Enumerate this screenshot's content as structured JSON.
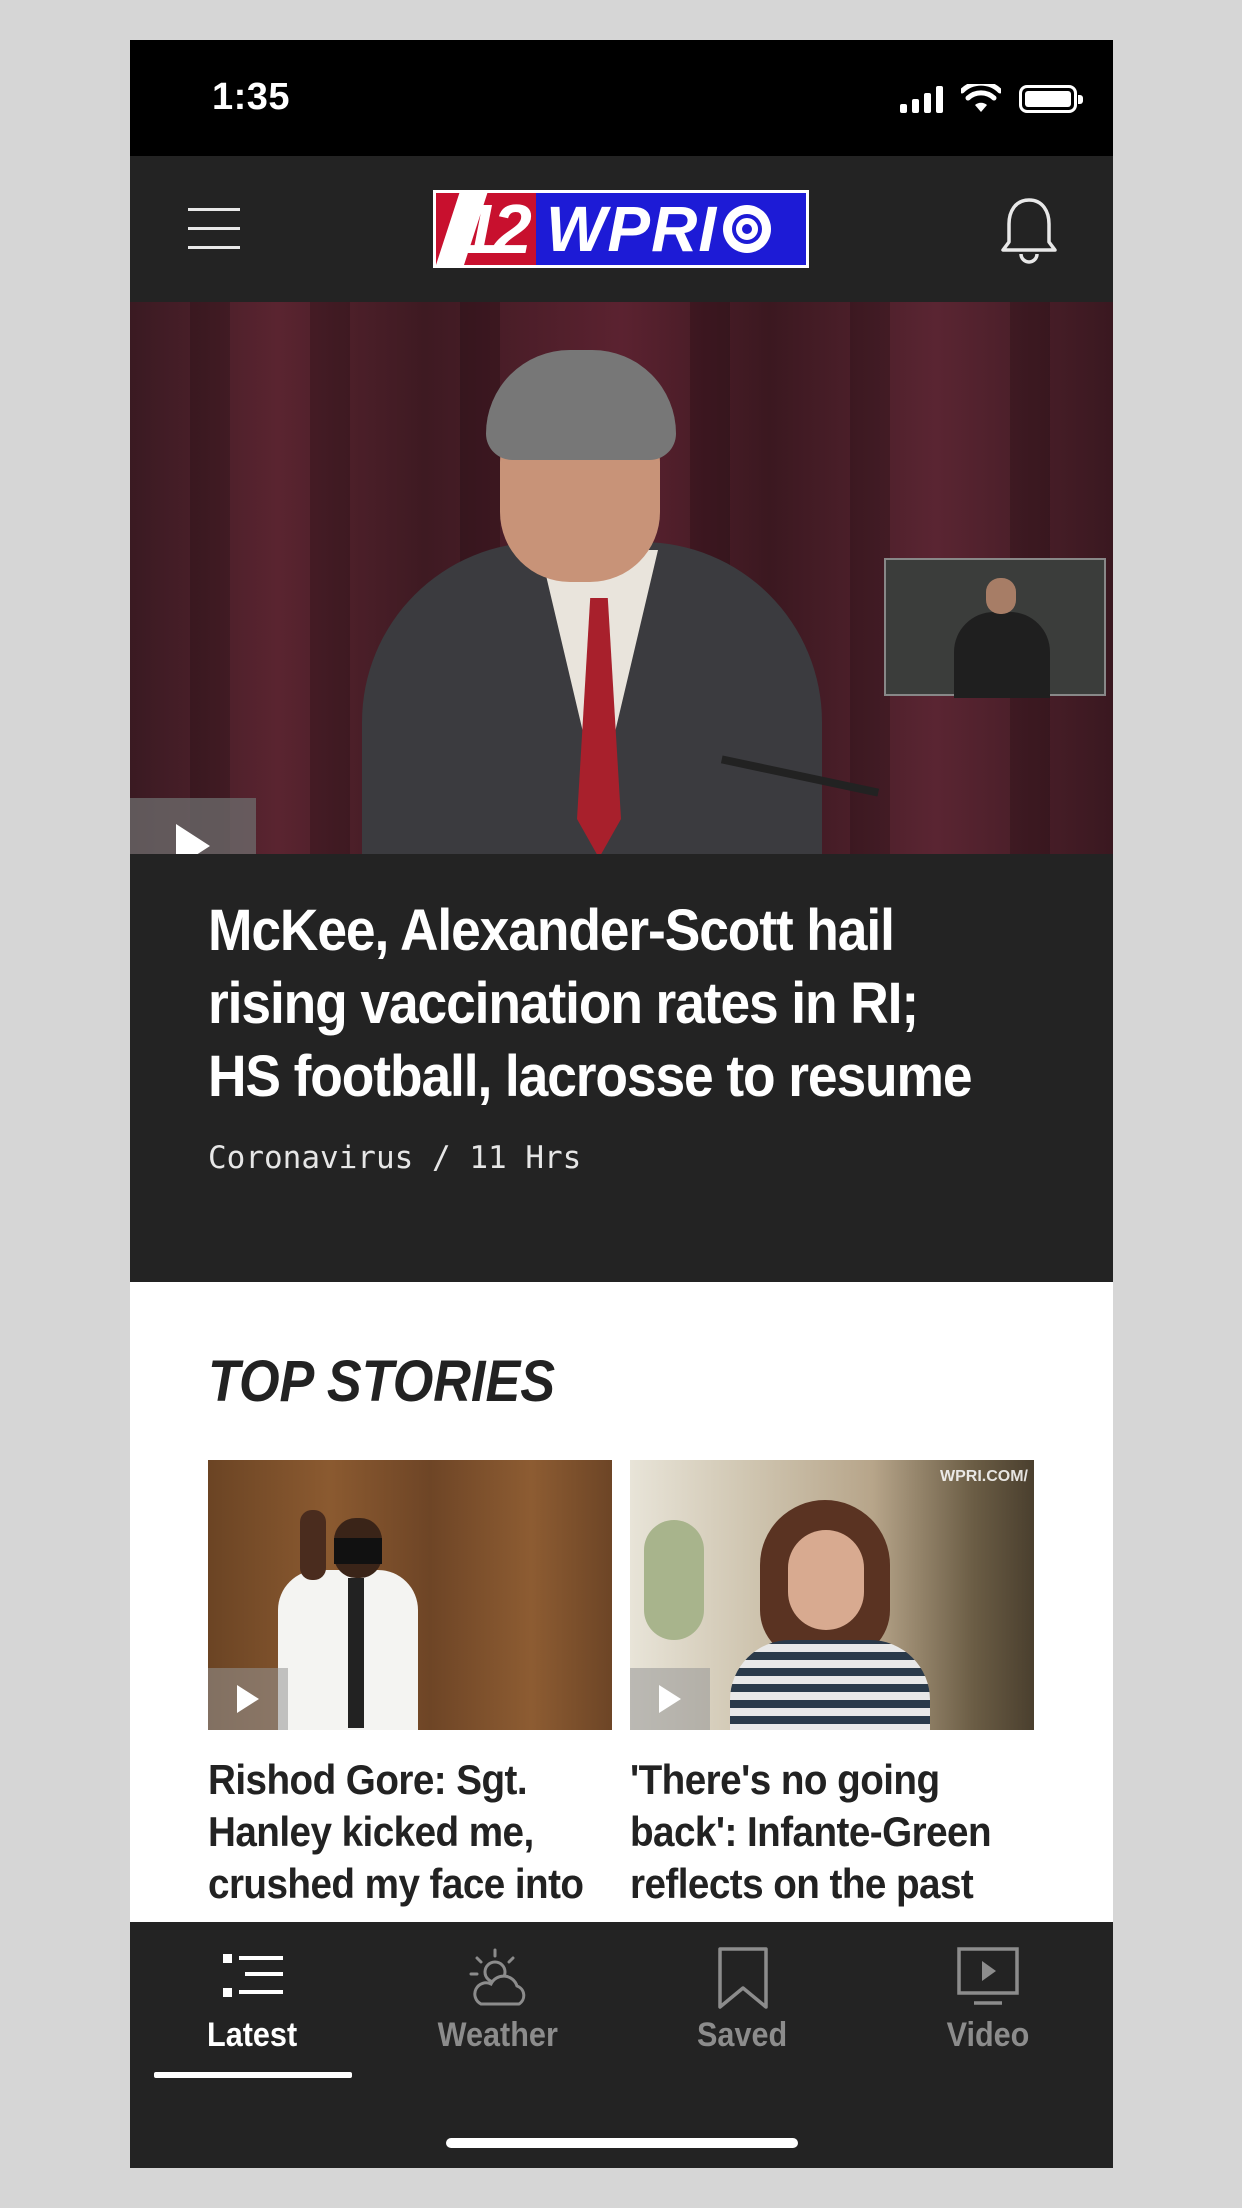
{
  "status_bar": {
    "time": "1:35"
  },
  "header": {
    "logo_number": "12",
    "logo_text": "WPRI"
  },
  "hero": {
    "title": "McKee, Alexander-Scott hail rising vaccination rates in RI; HS football, lacrosse to resume",
    "category": "Coronavirus",
    "separator": "/",
    "age": "11 Hrs"
  },
  "top_stories": {
    "heading": "TOP STORIES",
    "cards": [
      {
        "title": "Rishod Gore: Sgt. Hanley kicked me, crushed my face into"
      },
      {
        "title": "'There's no going back': Infante-Green reflects on the past",
        "watermark": "WPRI.COM/"
      }
    ]
  },
  "tabs": [
    {
      "label": "Latest",
      "icon": "list-icon",
      "active": true
    },
    {
      "label": "Weather",
      "icon": "partly-cloudy-icon",
      "active": false
    },
    {
      "label": "Saved",
      "icon": "bookmark-icon",
      "active": false
    },
    {
      "label": "Video",
      "icon": "video-play-icon",
      "active": false
    }
  ],
  "colors": {
    "background": "#232323",
    "brand_blue": "#1d1bd6",
    "brand_red": "#c8102e",
    "inactive_tab": "#8c8c8c"
  }
}
